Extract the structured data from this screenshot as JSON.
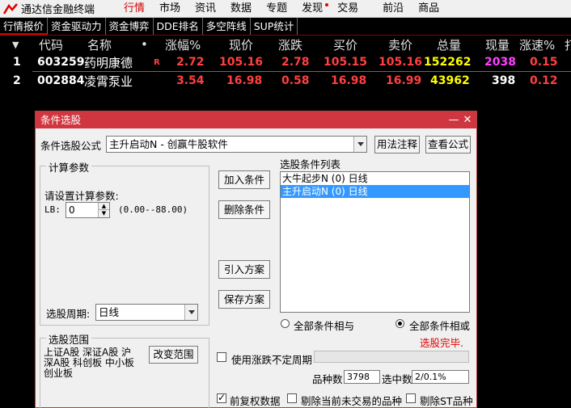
{
  "app": {
    "title": "通达信金融终端"
  },
  "menu": [
    "行情",
    "市场",
    "资讯",
    "数据",
    "专题",
    "发现",
    "交易",
    "前沿",
    "商品"
  ],
  "tabs": [
    "行情报价",
    "资金驱动力",
    "资金博弈",
    "DDE排名",
    "多空阵线",
    "SUP统计"
  ],
  "quote_header": {
    "sort_icon": "▼",
    "code": "代码",
    "name": "名称",
    "dot": "•",
    "change_pct": "涨幅%",
    "price": "现价",
    "change": "涨跌",
    "bid": "买价",
    "ask": "卖价",
    "volume": "总量",
    "cur_vol": "现量",
    "speed": "涨速%",
    "more": "打"
  },
  "quotes": [
    {
      "idx": "1",
      "code": "603259",
      "name": "药明康德",
      "flag": "R",
      "change_pct": "2.72",
      "price": "105.16",
      "change": "2.78",
      "bid": "105.15",
      "ask": "105.16",
      "volume": "152262",
      "cur_vol": "2038",
      "speed": "0.15"
    },
    {
      "idx": "2",
      "code": "002884",
      "name": "凌霄泵业",
      "flag": "",
      "change_pct": "3.54",
      "price": "16.98",
      "change": "0.58",
      "bid": "16.98",
      "ask": "16.99",
      "volume": "43962",
      "cur_vol": "398",
      "speed": "0.12"
    }
  ],
  "dialog": {
    "title": "条件选股",
    "minimize": "—",
    "close": "✕",
    "formula_label": "条件选股公式",
    "formula_value": "主升启动N    - 创赢牛股软件",
    "usage_button": "用法注释",
    "view_button": "查看公式",
    "params_group": "计算参数",
    "params_prompt": "请设置计算参数:",
    "lb_label": "LB:",
    "lb_value": "0",
    "lb_range": "(0.00--88.00)",
    "period_label": "选股周期:",
    "period_value": "日线",
    "add_button": "加入条件",
    "delete_button": "删除条件",
    "import_button": "引入方案",
    "save_button": "保存方案",
    "list_title": "选股条件列表",
    "conditions": [
      "大牛起步N (0) 日线",
      "主升启动N (0) 日线"
    ],
    "and_label": "全部条件相与",
    "or_label": "全部条件相或",
    "status": "选股完毕.",
    "scope_group": "选股范围",
    "scope_text": [
      "上证A股 深证A股 沪",
      "深A股 科创板 中小板",
      "创业板"
    ],
    "change_scope_button": "改变范围",
    "unfixed_label": "使用涨跌不定周期",
    "count_label": "品种数",
    "count_value": "3798",
    "selected_label": "选中数",
    "selected_value": "2/0.1%",
    "adjust_label": "前复权数据",
    "exclude_untraded_label": "剔除当前未交易的品种",
    "exclude_st_label": "剔除ST品种"
  },
  "colors": {
    "accent": "#d0363f",
    "up": "#ff4040",
    "volume": "#ffff00",
    "cur_vol": "#ff40ff"
  }
}
